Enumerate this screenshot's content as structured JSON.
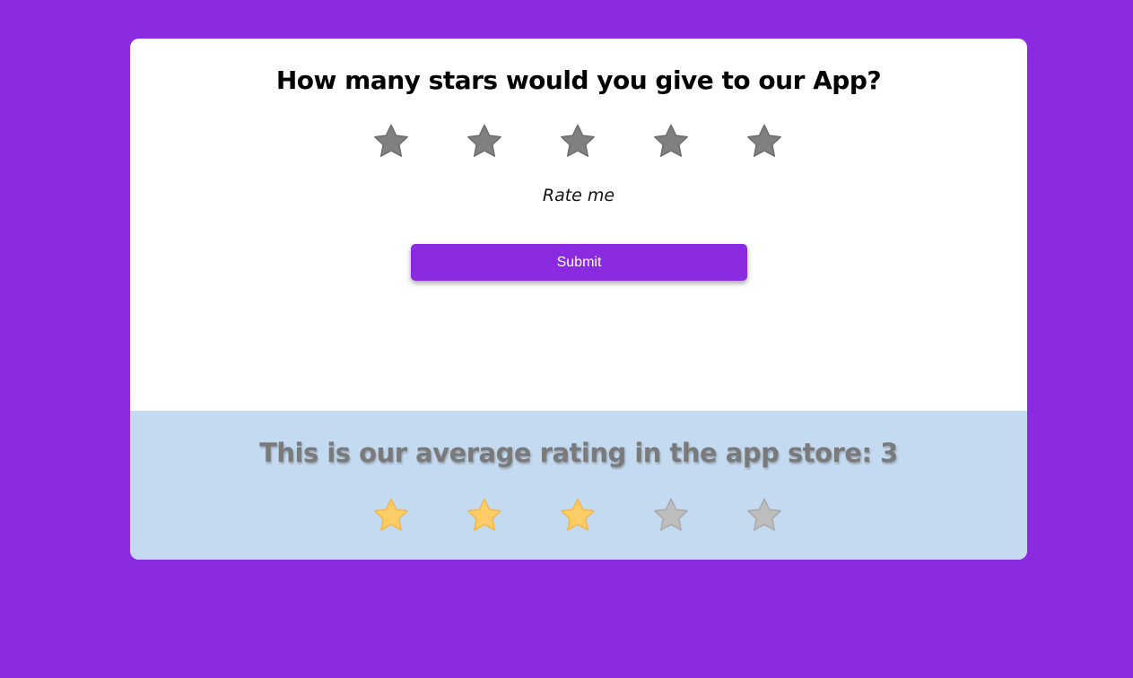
{
  "rating_form": {
    "question": "How many stars would you give to our App?",
    "star_count": 5,
    "selected_rating": 0,
    "star_empty_color": "#808080",
    "status_text": "Rate me",
    "submit_label": "Submit"
  },
  "average": {
    "title": "This is our average rating in the app store: 3",
    "rating": 3,
    "max": 5,
    "filled_color": "#ffcc66",
    "empty_color": "#bdbdbd"
  },
  "colors": {
    "background": "#8a2be2",
    "card": "#ffffff",
    "average_panel": "#c4daf0",
    "button": "#8a2be2"
  }
}
